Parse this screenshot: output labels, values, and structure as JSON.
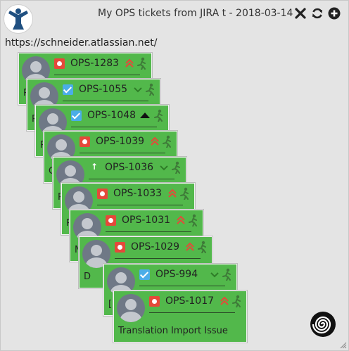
{
  "header": {
    "title": "My OPS tickets from JIRA t - 2018-03-14",
    "url": "https://schneider.atlassian.net/"
  },
  "colors": {
    "card_bg": "#52b84b",
    "bug": "#e5493a",
    "task": "#4bade8",
    "highest_priority": "#111111"
  },
  "tickets": [
    {
      "key": "OPS-1283",
      "type": "bug",
      "priority": "high",
      "summary": "P"
    },
    {
      "key": "OPS-1055",
      "type": "task",
      "priority": "low",
      "summary": "P"
    },
    {
      "key": "OPS-1048",
      "type": "task",
      "priority": "highest",
      "summary": "P"
    },
    {
      "key": "OPS-1039",
      "type": "bug",
      "priority": "high",
      "summary": "C"
    },
    {
      "key": "OPS-1036",
      "type": "improvement",
      "priority": "low",
      "summary": "P"
    },
    {
      "key": "OPS-1033",
      "type": "bug",
      "priority": "high",
      "summary": "P"
    },
    {
      "key": "OPS-1031",
      "type": "bug",
      "priority": "high",
      "summary": "N"
    },
    {
      "key": "OPS-1029",
      "type": "bug",
      "priority": "high",
      "summary": "D"
    },
    {
      "key": "OPS-994",
      "type": "task",
      "priority": "low",
      "summary": "[PRO"
    },
    {
      "key": "OPS-1017",
      "type": "bug",
      "priority": "high",
      "summary": "Translation Import Issue"
    }
  ]
}
